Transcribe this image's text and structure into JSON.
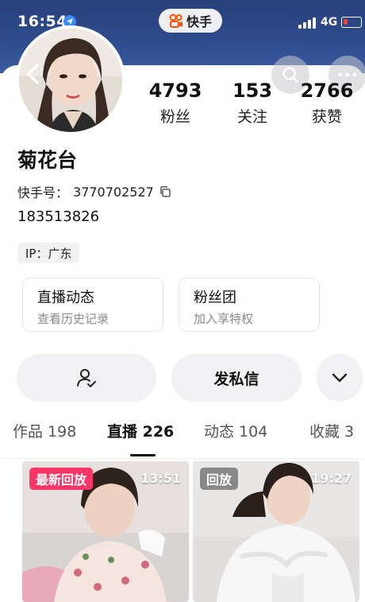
{
  "status_bar": {
    "time": "16:54",
    "network": "4G"
  },
  "app_badge": {
    "label": "快手"
  },
  "profile": {
    "name": "菊花台",
    "kuaishou_id_label": "快手号：",
    "kuaishou_id": "3770702527",
    "bio": "183513826",
    "ip_label": "IP：广东"
  },
  "stats": [
    {
      "value": "4793",
      "label": "粉丝"
    },
    {
      "value": "153",
      "label": "关注"
    },
    {
      "value": "2766",
      "label": "获赞"
    }
  ],
  "features": [
    {
      "title": "直播动态",
      "subtitle": "查看历史记录"
    },
    {
      "title": "粉丝团",
      "subtitle": "加入享特权"
    }
  ],
  "actions": {
    "message_label": "发私信"
  },
  "tabs": [
    {
      "label": "作品 198"
    },
    {
      "label": "直播 226"
    },
    {
      "label": "动态 104"
    },
    {
      "label": "收藏 3"
    }
  ],
  "thumbnails": [
    {
      "badge": "最新回放",
      "duration": "13:51"
    },
    {
      "badge": "回放",
      "duration": "19:27"
    }
  ],
  "colors": {
    "banner": "#2e4c8c",
    "badge_pink": "#fe3666",
    "battery_low": "#ff3b30"
  }
}
